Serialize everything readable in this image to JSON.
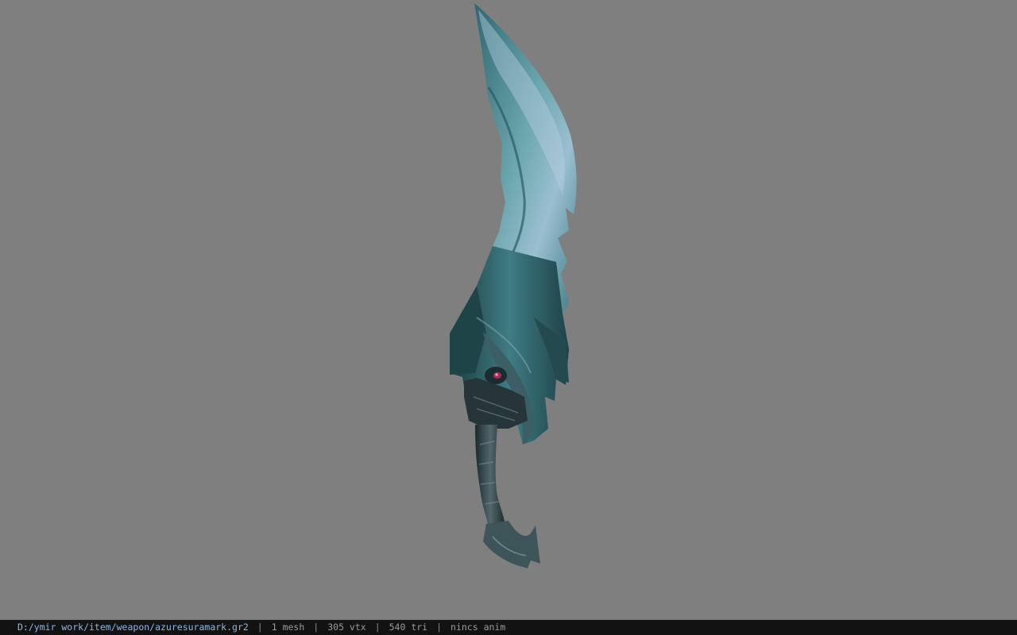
{
  "viewer": {
    "background_color": "#7f7f7f",
    "model_icon": "curved-sword-model"
  },
  "status": {
    "file_path": "D:/ymir work/item/weapon/azuresuramark.gr2",
    "separator": "|",
    "mesh_count": "1 mesh",
    "vertex_count": "305 vtx",
    "triangle_count": "540 tri",
    "anim_info": "nincs anim",
    "path_color": "#8fb8e0",
    "bar_color": "#121212"
  }
}
